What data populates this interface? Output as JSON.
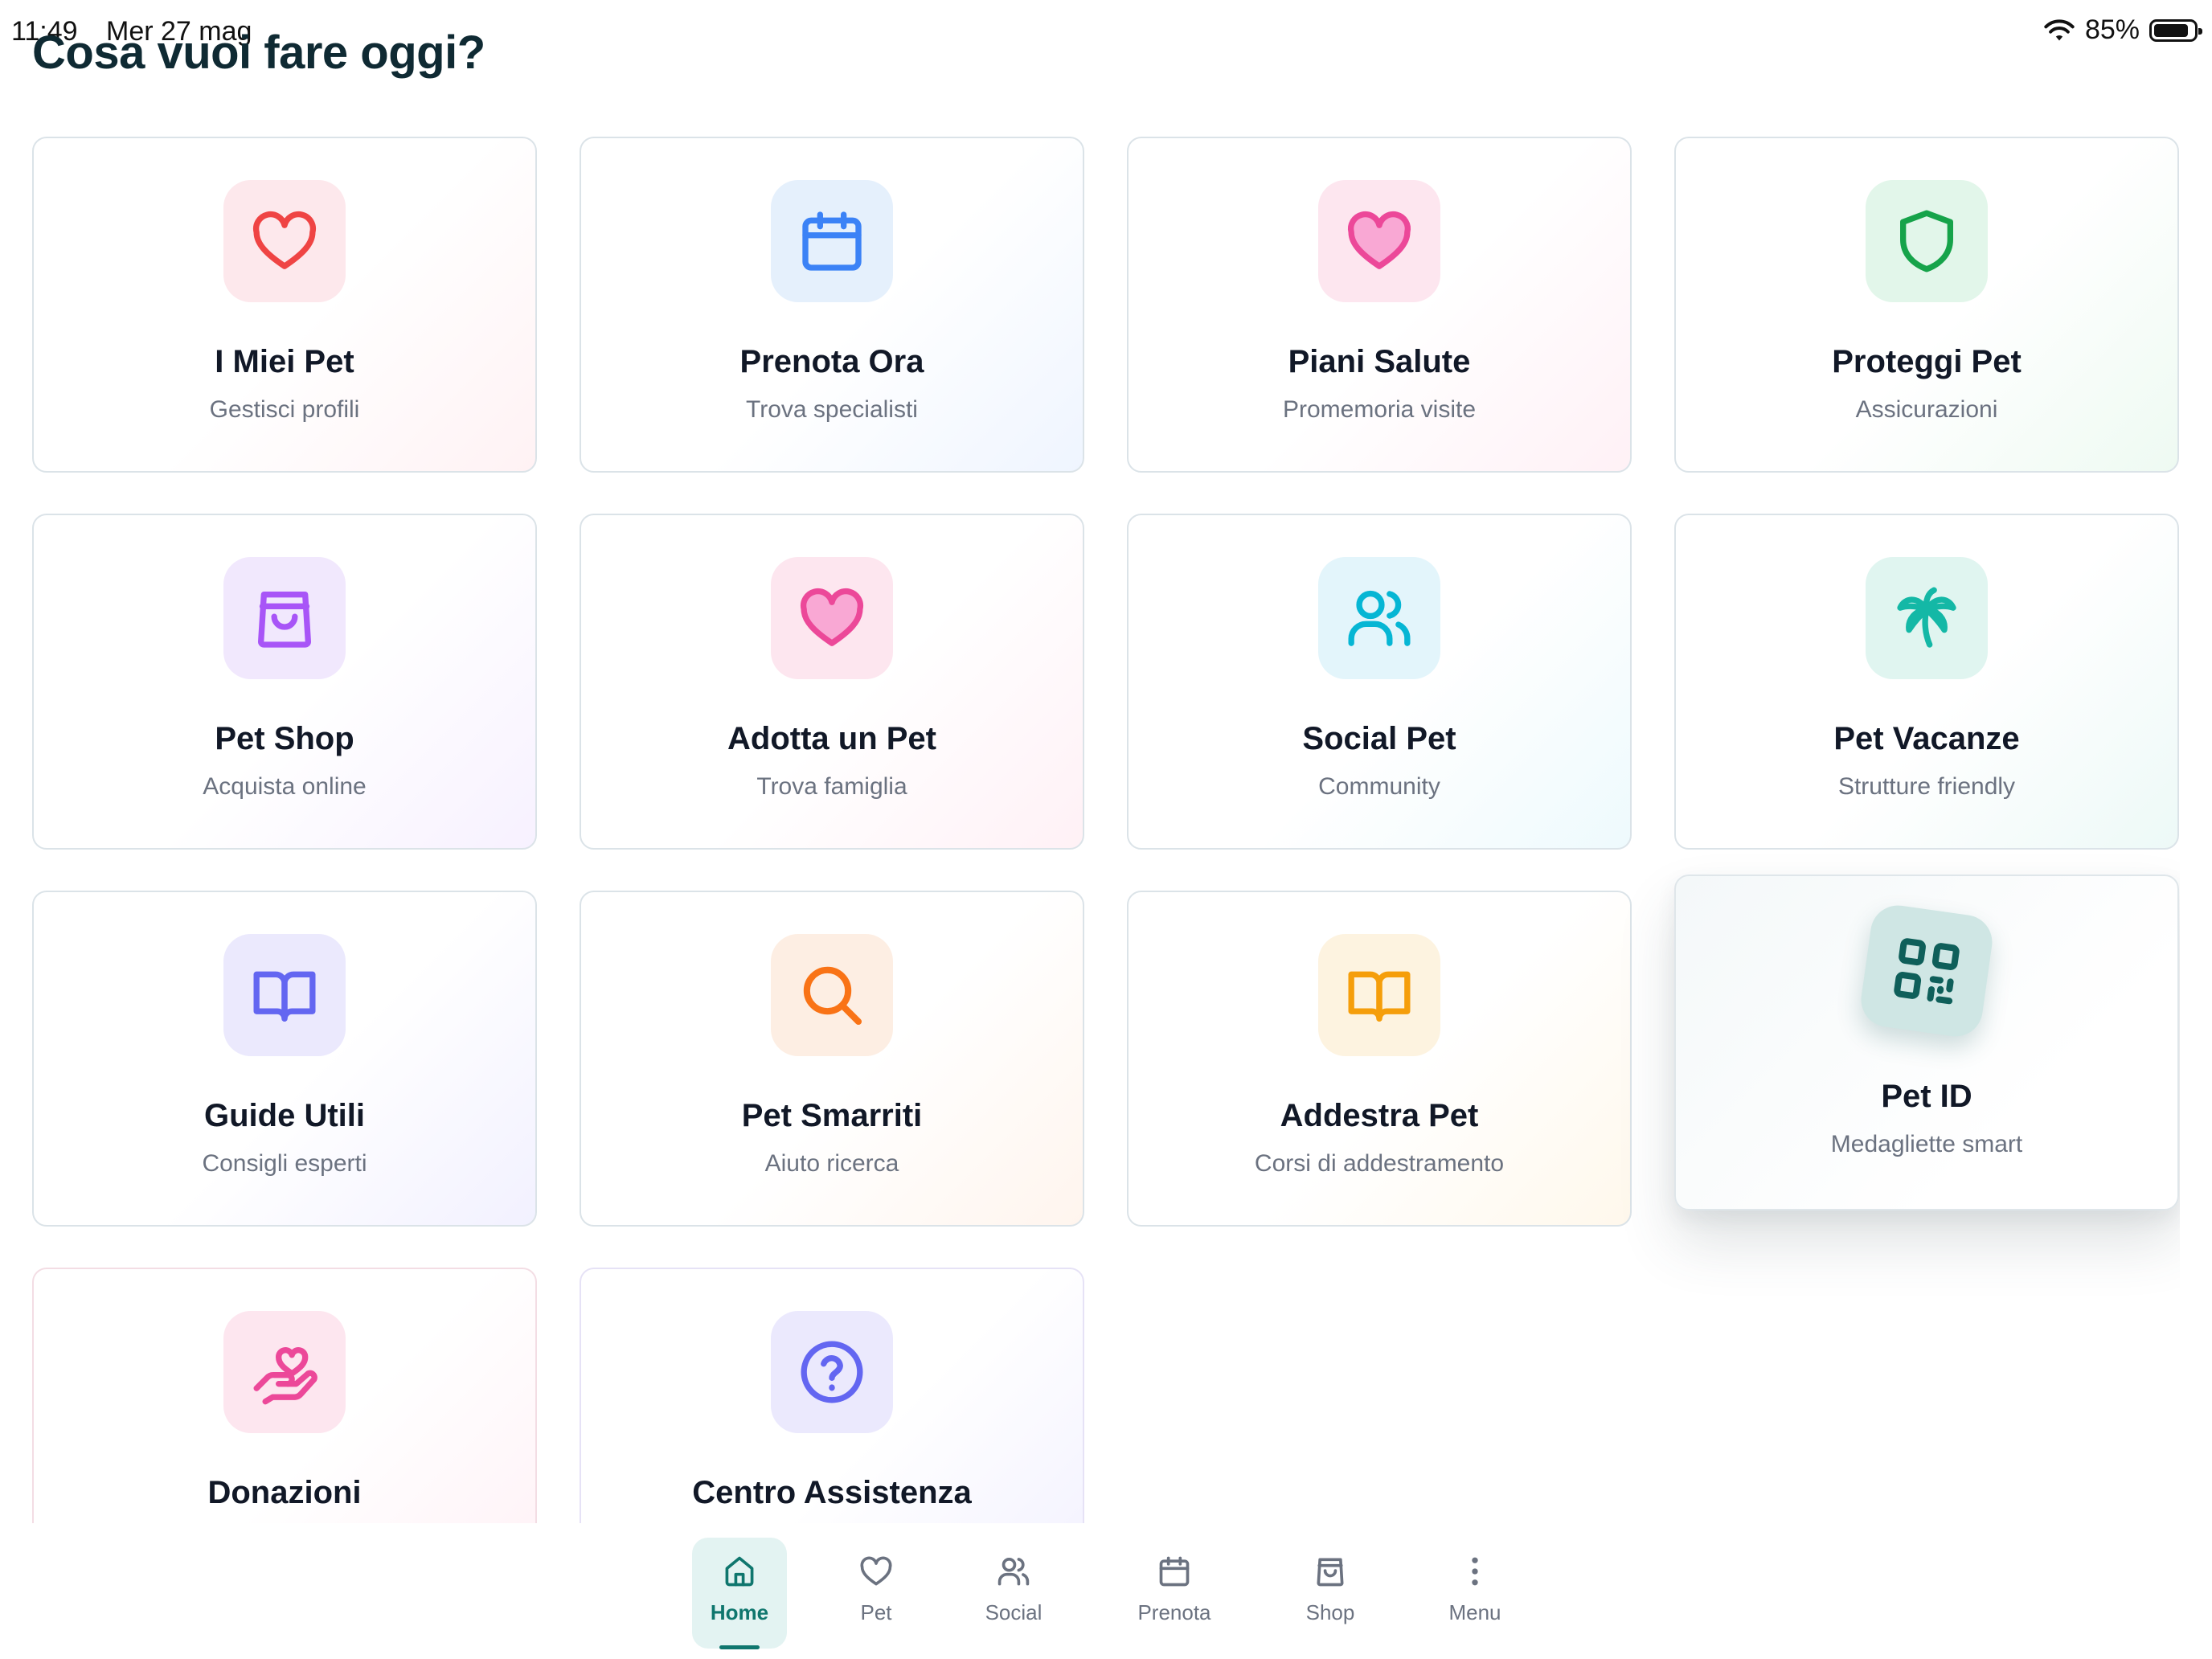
{
  "status_bar": {
    "time": "11:49",
    "date": "Mer 27 mag",
    "battery": "85%"
  },
  "header": {
    "title": "Cosa vuoi fare oggi?"
  },
  "cards": [
    {
      "title": "I Miei Pet",
      "subtitle": "Gestisci profili",
      "icon": "heart-outline-icon",
      "color": "#ef4444"
    },
    {
      "title": "Prenota Ora",
      "subtitle": "Trova specialisti",
      "icon": "calendar-icon",
      "color": "#3b82f6"
    },
    {
      "title": "Piani Salute",
      "subtitle": "Promemoria visite",
      "icon": "heart-filled-icon",
      "color": "#ec4899"
    },
    {
      "title": "Proteggi Pet",
      "subtitle": "Assicurazioni",
      "icon": "shield-icon",
      "color": "#16a34a"
    },
    {
      "title": "Pet Shop",
      "subtitle": "Acquista online",
      "icon": "shopping-bag-icon",
      "color": "#a855f7"
    },
    {
      "title": "Adotta un Pet",
      "subtitle": "Trova famiglia",
      "icon": "heart-filled-icon",
      "color": "#ec4899"
    },
    {
      "title": "Social Pet",
      "subtitle": "Community",
      "icon": "users-icon",
      "color": "#06b6d4"
    },
    {
      "title": "Pet Vacanze",
      "subtitle": "Strutture friendly",
      "icon": "palm-tree-icon",
      "color": "#14b8a6"
    },
    {
      "title": "Guide Utili",
      "subtitle": "Consigli esperti",
      "icon": "book-icon",
      "color": "#6366f1"
    },
    {
      "title": "Pet Smarriti",
      "subtitle": "Aiuto ricerca",
      "icon": "search-icon",
      "color": "#f97316"
    },
    {
      "title": "Addestra Pet",
      "subtitle": "Corsi di addestramento",
      "icon": "book-icon",
      "color": "#f59e0b"
    },
    {
      "title": "Pet ID",
      "subtitle": "Medagliette smart",
      "icon": "qr-code-icon",
      "color": "#0f766e"
    },
    {
      "title": "Donazioni",
      "subtitle": "",
      "icon": "hand-heart-icon",
      "color": "#ec4899"
    },
    {
      "title": "Centro Assistenza",
      "subtitle": "",
      "icon": "help-circle-icon",
      "color": "#6366f1"
    }
  ],
  "nav": {
    "items": [
      {
        "label": "Home",
        "icon": "home-icon",
        "active": true
      },
      {
        "label": "Pet",
        "icon": "heart-icon"
      },
      {
        "label": "Social",
        "icon": "users-icon"
      },
      {
        "label": "Prenota",
        "icon": "calendar-icon"
      },
      {
        "label": "Shop",
        "icon": "shopping-bag-icon"
      },
      {
        "label": "Menu",
        "icon": "more-vertical-icon"
      }
    ],
    "accent": "#0f766e"
  }
}
